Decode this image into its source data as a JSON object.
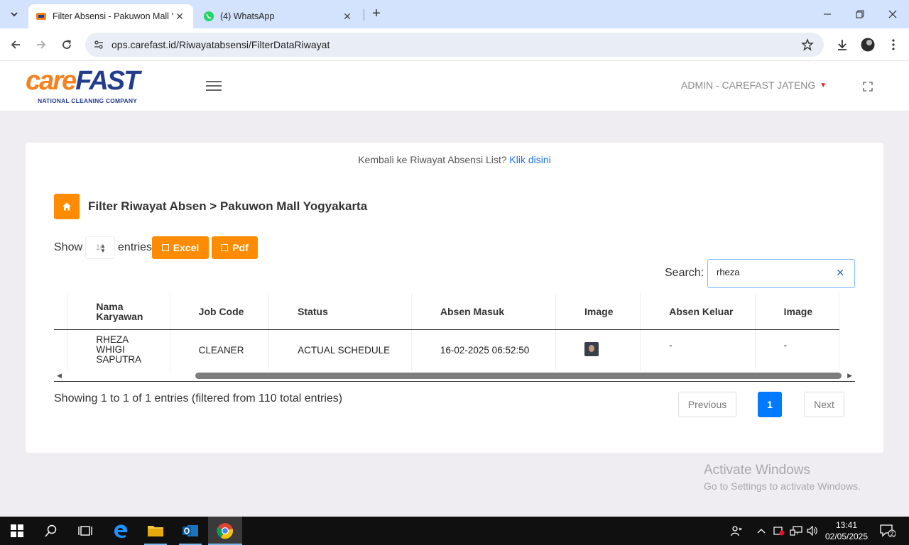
{
  "browser": {
    "tabs": [
      {
        "title": "Filter Absensi - Pakuwon Mall Y",
        "active": true
      },
      {
        "title": "(4) WhatsApp",
        "active": false
      }
    ],
    "url": "ops.carefast.id/Riwayatabsensi/FilterDataRiwayat"
  },
  "header": {
    "logo_care": "care",
    "logo_fast": "FAST",
    "logo_tagline": "NATIONAL CLEANING COMPANY",
    "admin_label": "ADMIN - CAREFAST JATENG"
  },
  "card": {
    "back_text": "Kembali ke Riwayat Absensi List?",
    "back_link": "Klik disini",
    "title": "Filter Riwayat Absen > Pakuwon Mall Yogyakarta",
    "show_label": "Show",
    "entries_value": "10",
    "entries_label": "entries",
    "excel_label": "Excel",
    "pdf_label": "Pdf",
    "search_label": "Search:",
    "search_value": "rheza"
  },
  "table": {
    "columns": [
      "",
      "Nama Karyawan",
      "Job Code",
      "Status",
      "Absen Masuk",
      "Image",
      "Absen Keluar",
      "Image"
    ],
    "rows": [
      {
        "nama": "RHEZA WHIGI SAPUTRA",
        "job_code": "CLEANER",
        "status": "ACTUAL SCHEDULE",
        "absen_masuk": "16-02-2025 06:52:50",
        "absen_keluar": "-",
        "image_keluar": "-"
      }
    ]
  },
  "footer": {
    "info": "Showing 1 to 1 of 1 entries (filtered from 110 total entries)",
    "previous": "Previous",
    "page": "1",
    "next": "Next"
  },
  "watermark": {
    "line1": "Activate Windows",
    "line2": "Go to Settings to activate Windows."
  },
  "taskbar": {
    "time": "13:41",
    "date": "02/05/2025",
    "notifications": "2"
  },
  "colors": {
    "accent_orange": "#ff8c00",
    "brand_blue": "#233c8e",
    "link_blue": "#1a73e8",
    "page_active": "#007bff"
  }
}
